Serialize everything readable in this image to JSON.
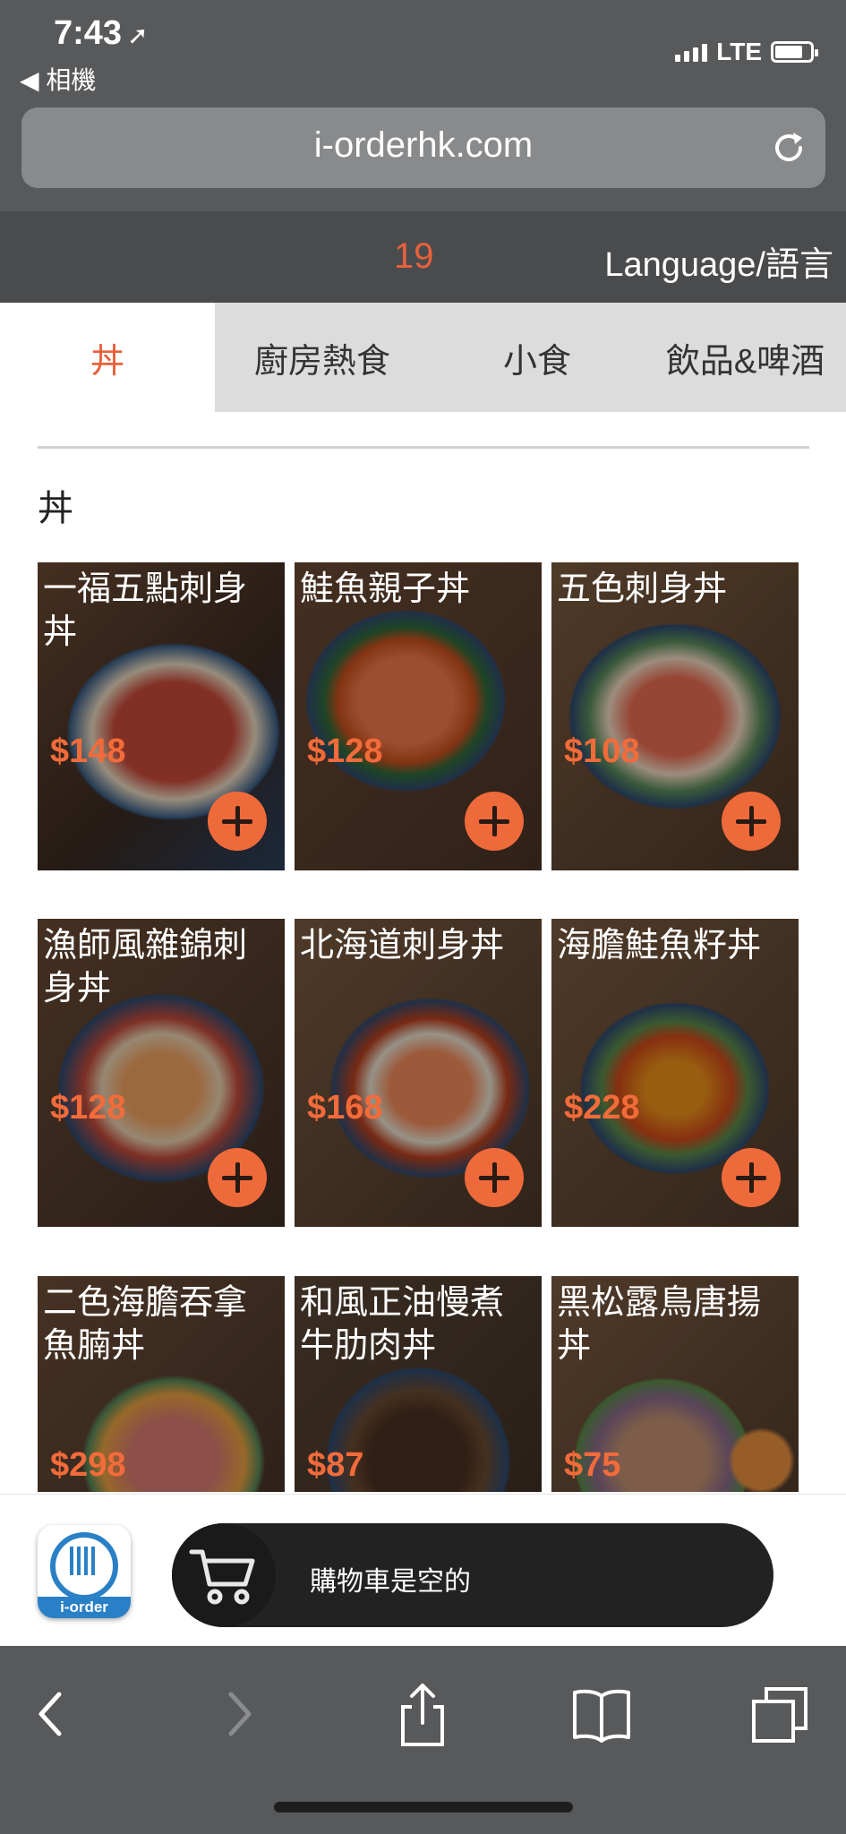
{
  "status_bar": {
    "time": "7:43",
    "back_app": "◀ 相機",
    "network": "LTE",
    "battery_level": 0.8
  },
  "browser": {
    "url": "i-orderhk.com"
  },
  "header": {
    "table_number": "19",
    "language_label": "Language/語言"
  },
  "tabs": [
    {
      "label": "丼",
      "active": true
    },
    {
      "label": "廚房熱食",
      "active": false
    },
    {
      "label": "小食",
      "active": false
    },
    {
      "label": "飲品&啤酒",
      "active": false
    }
  ],
  "section": {
    "title": "丼"
  },
  "items": [
    {
      "name": "一福五點刺身丼",
      "price": "$148"
    },
    {
      "name": "鮭魚親子丼",
      "price": "$128"
    },
    {
      "name": "五色刺身丼",
      "price": "$108"
    },
    {
      "name": "漁師風雜錦刺身丼",
      "price": "$128"
    },
    {
      "name": "北海道刺身丼",
      "price": "$168"
    },
    {
      "name": "海膽鮭魚籽丼",
      "price": "$228"
    },
    {
      "name": "二色海膽吞拿魚腩丼",
      "price": "$298"
    },
    {
      "name": "和風正油慢煮牛肋肉丼",
      "price": "$87"
    },
    {
      "name": "黑松露鳥唐揚丼",
      "price": "$75"
    }
  ],
  "cart": {
    "status_text": "購物車是空的",
    "logo_text": "i-order"
  },
  "colors": {
    "accent": "#e8613c",
    "chrome": "#58595b",
    "header": "#4a4b4d"
  }
}
